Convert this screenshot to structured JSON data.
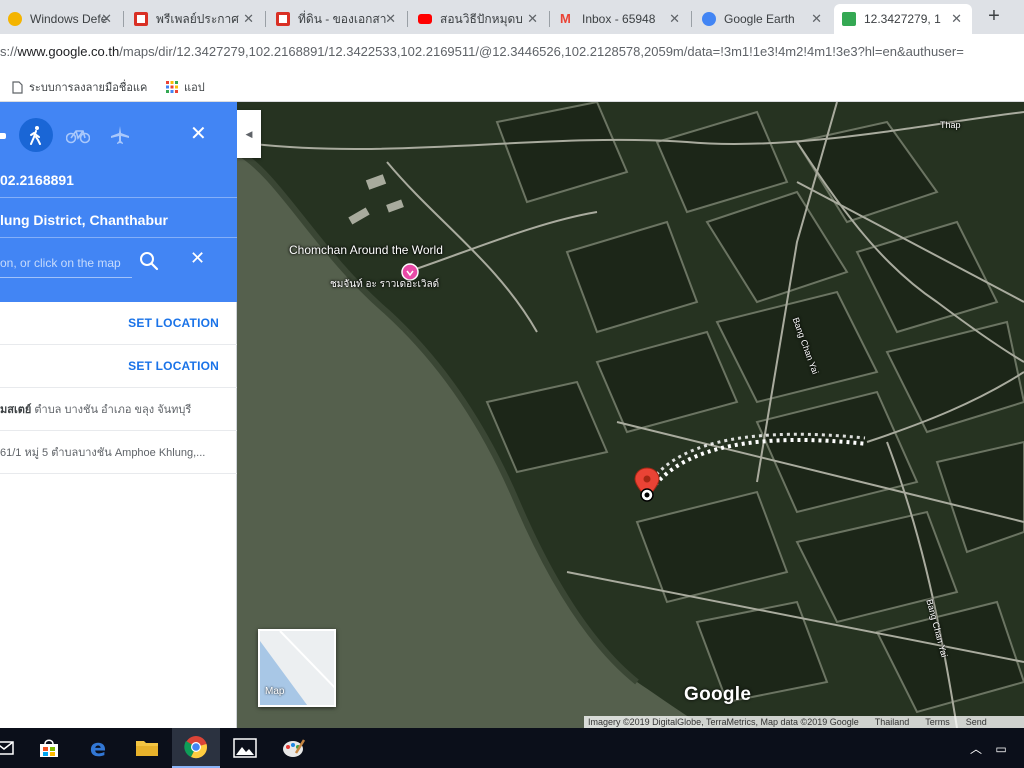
{
  "browser": {
    "tabs": [
      {
        "title": "Windows Defe",
        "icon": "windows-defender-icon",
        "color": "#f4b400"
      },
      {
        "title": "พรีเพลย์ประกาศ",
        "icon": "page-icon-red",
        "color": "#d93025"
      },
      {
        "title": "ที่ดิน - ของเอกสา",
        "icon": "page-icon-red",
        "color": "#d93025"
      },
      {
        "title": "สอนวิธีปักหมุดบ",
        "icon": "youtube-icon",
        "color": "#ff0000"
      },
      {
        "title": "Inbox - 65948",
        "icon": "gmail-icon",
        "color": "#ea4335"
      },
      {
        "title": "Google Earth",
        "icon": "google-earth-icon",
        "color": "#4285f4"
      },
      {
        "title": "12.3427279, 1",
        "icon": "google-maps-icon",
        "color": "#34a853"
      }
    ],
    "url_prefix": "s://",
    "url_domain": "www.google.co.th",
    "url_path": "/maps/dir/12.3427279,102.2168891/12.3422533,102.2169511/@12.3446526,102.2128578,2059m/data=!3m1!1e3!4m2!4m1!3e3?hl=en&authuser=",
    "bookmarks": [
      {
        "label": "ระบบการลงลายมือชื่อแค",
        "icon": "doc-icon"
      },
      {
        "label": "แอป",
        "icon": "apps-grid-icon"
      }
    ]
  },
  "directions": {
    "travel_modes": [
      "car-icon",
      "walk-icon",
      "bike-icon",
      "flight-icon"
    ],
    "selected_mode": "walk-icon",
    "origin": "02.2168891",
    "destination_text": "lung District, Chanthabur",
    "destination_placeholder": "on, or click on the map",
    "rows": [
      {
        "action": "SET LOCATION"
      },
      {
        "action": "SET LOCATION"
      },
      {
        "bold": "มสเตย์",
        "text": " ตำบล บางชัน อำเภอ ขลุง จันทบุรี"
      },
      {
        "text": "61/1 หมู่ 5 ตำบลบางชัน Amphoe Khlung,..."
      }
    ],
    "accent_color": "#4285f4"
  },
  "map": {
    "poi_name": "Chomchan Around the World",
    "poi_thai": "ชมจันท์ อะ ราวเดอะเวิลด์",
    "road_labels": [
      "Thap",
      "Bang Chan Yai",
      "Bang Chan Yai"
    ],
    "logo": "Google",
    "minimap_label": "Map",
    "attribution": [
      "Imagery ©2019 DigitalGlobe, TerraMetrics, Map data ©2019 Google",
      "Thailand",
      "Terms",
      "Send"
    ]
  },
  "taskbar": {
    "apps": [
      "mail-icon",
      "store-icon",
      "edge-icon",
      "file-explorer-icon",
      "chrome-icon",
      "photos-icon",
      "paint-icon"
    ],
    "active_app": "chrome-icon"
  }
}
